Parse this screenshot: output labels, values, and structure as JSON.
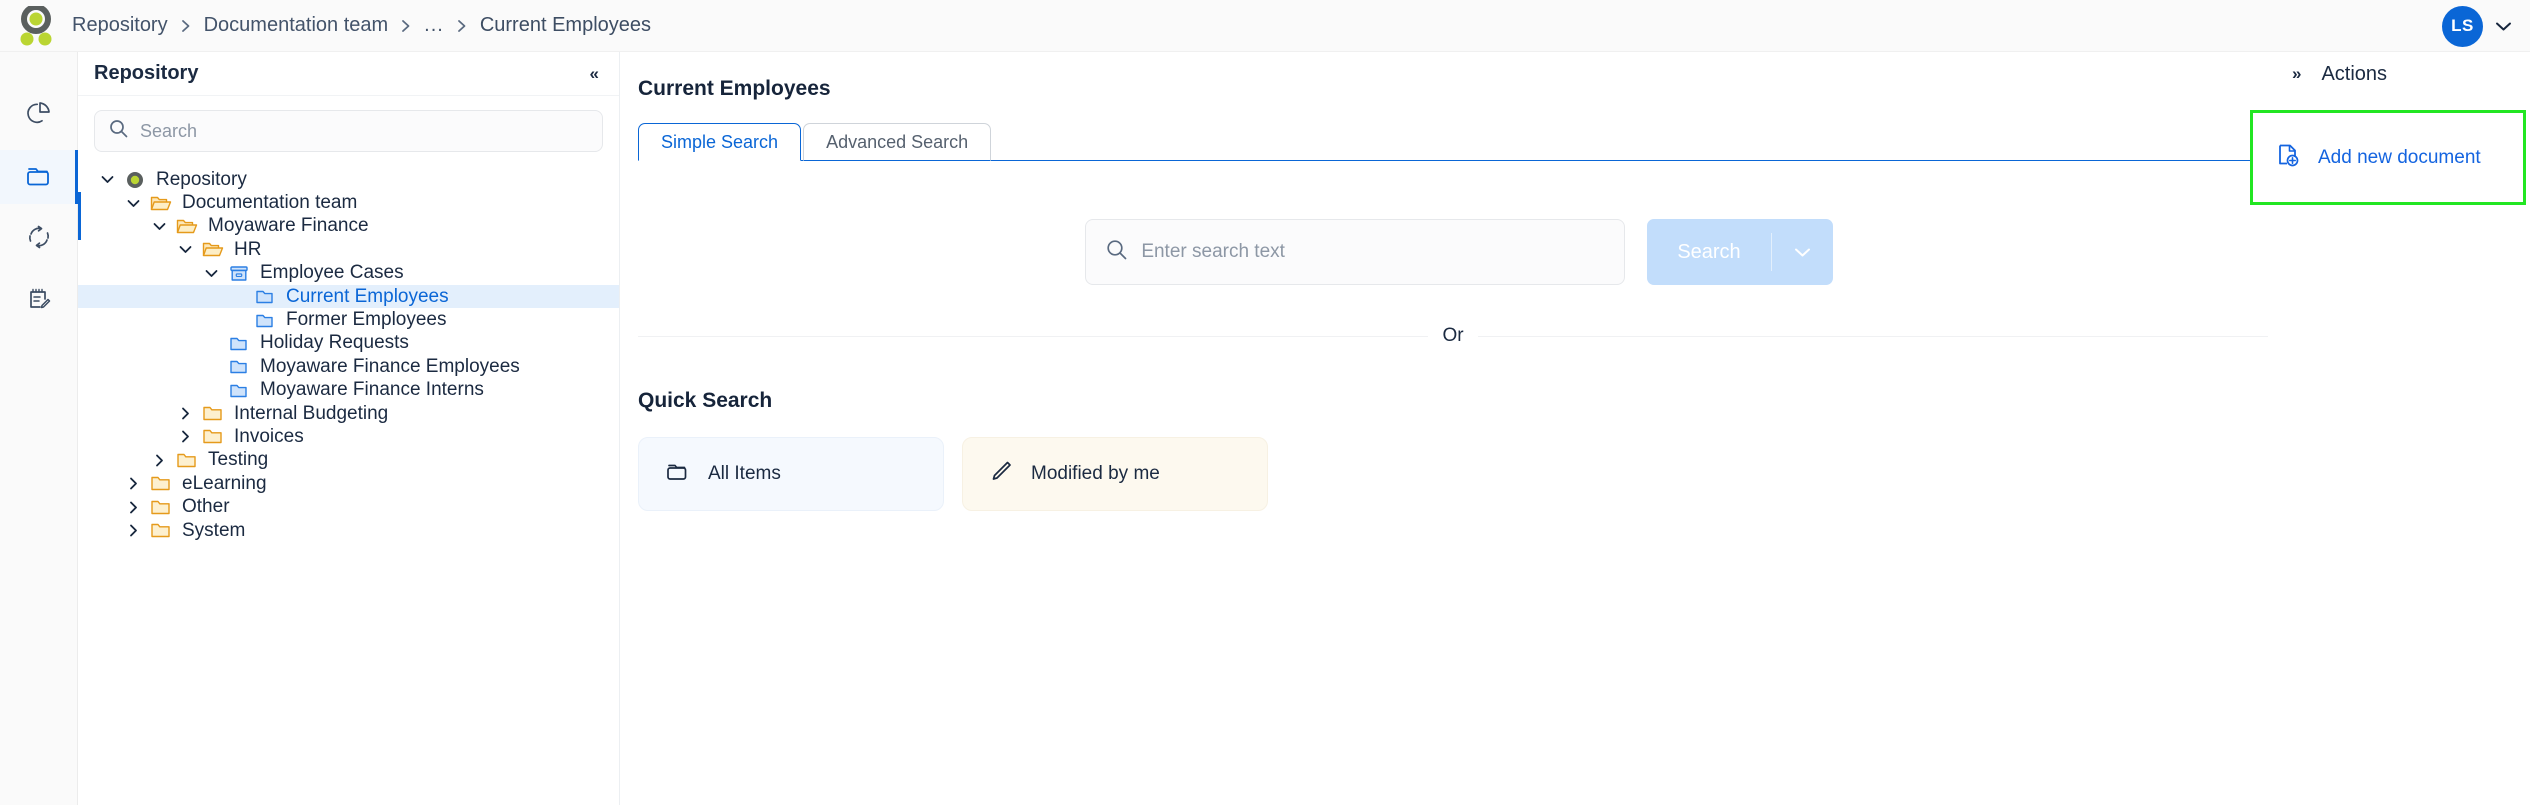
{
  "topbar": {
    "logo_icon": "app-logo",
    "breadcrumb": [
      {
        "label": "Repository"
      },
      {
        "label": "Documentation team"
      },
      {
        "label": "..."
      },
      {
        "label": "Current Employees"
      }
    ],
    "avatar_initials": "LS",
    "avatar_caret_icon": "chevron-down-icon",
    "avatar_color": "#0a66d6"
  },
  "rail": {
    "items": [
      {
        "icon": "pie-chart-icon",
        "active": false
      },
      {
        "icon": "folder-icon",
        "active": true
      },
      {
        "icon": "refresh-icon",
        "active": false
      },
      {
        "icon": "notes-edit-icon",
        "active": false
      }
    ]
  },
  "sidebar": {
    "title": "Repository",
    "collapse_icon": "collapse-left-icon",
    "collapse_glyph": "«",
    "search": {
      "icon": "search-icon",
      "placeholder": "Search",
      "value": ""
    },
    "tree": [
      {
        "label": "Repository",
        "depth": 0,
        "icon": "repository-icon",
        "twisty": "down",
        "selected": false
      },
      {
        "label": "Documentation team",
        "depth": 1,
        "icon": "folder-open-icon",
        "twisty": "down",
        "selected": false
      },
      {
        "label": "Moyaware Finance",
        "depth": 2,
        "icon": "folder-open-icon",
        "twisty": "down",
        "selected": false
      },
      {
        "label": "HR",
        "depth": 3,
        "icon": "folder-open-icon",
        "twisty": "down",
        "selected": false
      },
      {
        "label": "Employee Cases",
        "depth": 4,
        "icon": "archive-box-icon",
        "twisty": "down",
        "selected": false
      },
      {
        "label": "Current Employees",
        "depth": 5,
        "icon": "doc-folder-icon",
        "twisty": "none",
        "selected": true
      },
      {
        "label": "Former Employees",
        "depth": 5,
        "icon": "doc-folder-icon",
        "twisty": "none",
        "selected": false
      },
      {
        "label": "Holiday Requests",
        "depth": 4,
        "icon": "doc-folder-icon",
        "twisty": "none",
        "selected": false
      },
      {
        "label": "Moyaware Finance Employees",
        "depth": 4,
        "icon": "doc-folder-icon",
        "twisty": "none",
        "selected": false
      },
      {
        "label": "Moyaware Finance Interns",
        "depth": 4,
        "icon": "doc-folder-icon",
        "twisty": "none",
        "selected": false
      },
      {
        "label": "Internal Budgeting",
        "depth": 3,
        "icon": "folder-closed-icon",
        "twisty": "right",
        "selected": false
      },
      {
        "label": "Invoices",
        "depth": 3,
        "icon": "folder-closed-icon",
        "twisty": "right",
        "selected": false
      },
      {
        "label": "Testing",
        "depth": 2,
        "icon": "folder-closed-icon",
        "twisty": "right",
        "selected": false
      },
      {
        "label": "eLearning",
        "depth": 1,
        "icon": "folder-closed-icon",
        "twisty": "right",
        "selected": false
      },
      {
        "label": "Other",
        "depth": 1,
        "icon": "folder-closed-icon",
        "twisty": "right",
        "selected": false
      },
      {
        "label": "System",
        "depth": 1,
        "icon": "folder-closed-icon",
        "twisty": "right",
        "selected": false
      }
    ]
  },
  "main": {
    "page_title": "Current Employees",
    "tabs": [
      {
        "label": "Simple Search",
        "active": true
      },
      {
        "label": "Advanced Search",
        "active": false
      }
    ],
    "search": {
      "icon": "search-icon",
      "placeholder": "Enter search text",
      "value": "",
      "button_label": "Search",
      "button_caret_icon": "chevron-down-icon",
      "button_disabled": true
    },
    "or_label": "Or",
    "quick_search": {
      "title": "Quick Search",
      "cards": [
        {
          "label": "All Items",
          "icon": "folder-outline-icon",
          "style": "blue"
        },
        {
          "label": "Modified by me",
          "icon": "pencil-icon",
          "style": "cream"
        }
      ]
    }
  },
  "actions": {
    "expand_icon": "expand-right-icon",
    "expand_glyph": "»",
    "title": "Actions",
    "highlight_color": "#22e622",
    "items": [
      {
        "label": "Add new document",
        "icon": "add-document-icon"
      }
    ]
  }
}
